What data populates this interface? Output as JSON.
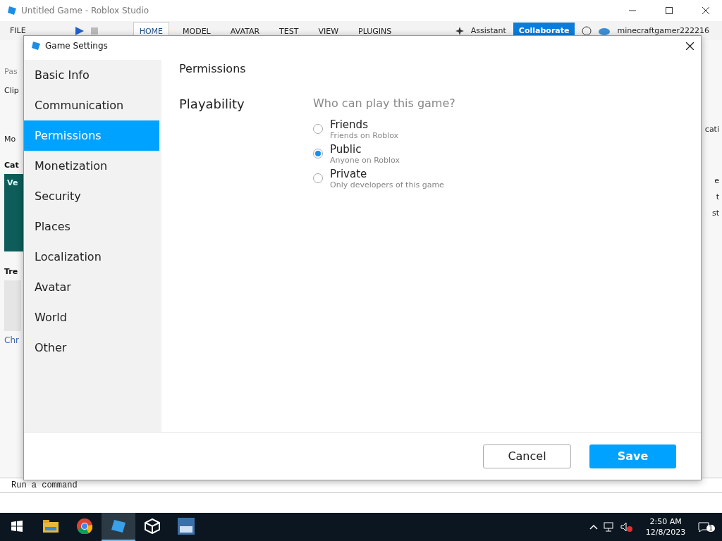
{
  "window": {
    "title": "Untitled Game - Roblox Studio"
  },
  "menu": {
    "file": "FILE",
    "tabs": [
      {
        "label": "HOME",
        "selected": true
      },
      {
        "label": "MODEL",
        "selected": false
      },
      {
        "label": "AVATAR",
        "selected": false
      },
      {
        "label": "TEST",
        "selected": false
      },
      {
        "label": "VIEW",
        "selected": false
      },
      {
        "label": "PLUGINS",
        "selected": false
      }
    ],
    "assistant": "Assistant",
    "collaborate": "Collaborate",
    "user": "minecraftgamer222216"
  },
  "background_left": {
    "paste": "Pas",
    "clipboard": "Clip",
    "dropdown": "Mo",
    "section_1": "Cat",
    "card_1": "Ve",
    "section_2": "Tre",
    "link": "Chr"
  },
  "background_right": [
    "cati",
    "e",
    "t",
    "st"
  ],
  "command_bar": {
    "placeholder": "Run a command"
  },
  "dialog": {
    "title": "Game Settings",
    "sidebar": [
      {
        "label": "Basic Info",
        "selected": false
      },
      {
        "label": "Communication",
        "selected": false
      },
      {
        "label": "Permissions",
        "selected": true
      },
      {
        "label": "Monetization",
        "selected": false
      },
      {
        "label": "Security",
        "selected": false
      },
      {
        "label": "Places",
        "selected": false
      },
      {
        "label": "Localization",
        "selected": false
      },
      {
        "label": "Avatar",
        "selected": false
      },
      {
        "label": "World",
        "selected": false
      },
      {
        "label": "Other",
        "selected": false
      }
    ],
    "heading": "Permissions",
    "section": "Playability",
    "question": "Who can play this game?",
    "options": [
      {
        "label": "Friends",
        "description": "Friends on Roblox",
        "selected": false
      },
      {
        "label": "Public",
        "description": "Anyone on Roblox",
        "selected": true
      },
      {
        "label": "Private",
        "description": "Only developers of this game",
        "selected": false
      }
    ],
    "buttons": {
      "cancel": "Cancel",
      "save": "Save"
    }
  },
  "taskbar": {
    "apps": [
      {
        "kind": "explorer",
        "selected": false
      },
      {
        "kind": "chrome",
        "selected": false
      },
      {
        "kind": "studio",
        "selected": true
      },
      {
        "kind": "cube",
        "selected": false
      },
      {
        "kind": "tool",
        "selected": false
      }
    ],
    "time": "2:50 AM",
    "date": "12/8/2023",
    "notifications": "1"
  }
}
